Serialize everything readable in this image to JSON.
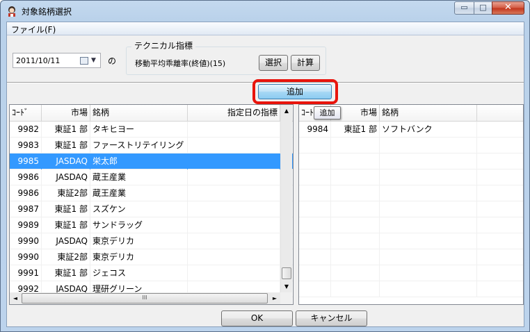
{
  "window": {
    "title": "対象銘柄選択",
    "minimize": "▭",
    "maximize": "□",
    "close": "✕"
  },
  "menu": {
    "file": "ファイル(F)"
  },
  "date": {
    "value": "2011/10/11",
    "suffix": "の"
  },
  "indicator": {
    "group_title": "テクニカル指標",
    "value": "移動平均乖離率(終値)(15)",
    "select_label": "選択",
    "calc_label": "計算"
  },
  "add_button": {
    "label": "追加",
    "tooltip": "追加"
  },
  "left_list": {
    "headers": [
      "ｺｰﾄﾞ",
      "市場",
      "銘柄",
      "指定日の指標"
    ],
    "rows": [
      [
        "9982",
        "東証1 部",
        "タキヒヨー",
        ""
      ],
      [
        "9983",
        "東証1 部",
        "ファーストリテイリング",
        ""
      ],
      [
        "9985",
        "JASDAQ",
        "栄太郎",
        ""
      ],
      [
        "9986",
        "JASDAQ",
        "蔵王産業",
        ""
      ],
      [
        "9986",
        "東証2部",
        "蔵王産業",
        ""
      ],
      [
        "9987",
        "東証1 部",
        "スズケン",
        ""
      ],
      [
        "9989",
        "東証1 部",
        "サンドラッグ",
        ""
      ],
      [
        "9990",
        "JASDAQ",
        "東京デリカ",
        ""
      ],
      [
        "9990",
        "東証2部",
        "東京デリカ",
        ""
      ],
      [
        "9991",
        "東証1 部",
        "ジェコス",
        ""
      ],
      [
        "9992",
        "JASDAQ",
        "理研グリーン",
        ""
      ]
    ],
    "selected_index": 2
  },
  "right_list": {
    "headers": [
      "ｺｰﾄﾞ",
      "市場",
      "銘柄"
    ],
    "rows": [
      [
        "9984",
        "東証1 部",
        "ソフトバンク"
      ]
    ]
  },
  "footer": {
    "ok_label": "OK",
    "cancel_label": "キャンセル"
  },
  "scroll": {
    "up": "▲",
    "down": "▼",
    "left": "◄",
    "right": "►",
    "grip": "III"
  },
  "colors": {
    "selection": "#3399ff",
    "highlight_ring": "#e8140c",
    "add_button": "#8ccbf1"
  }
}
